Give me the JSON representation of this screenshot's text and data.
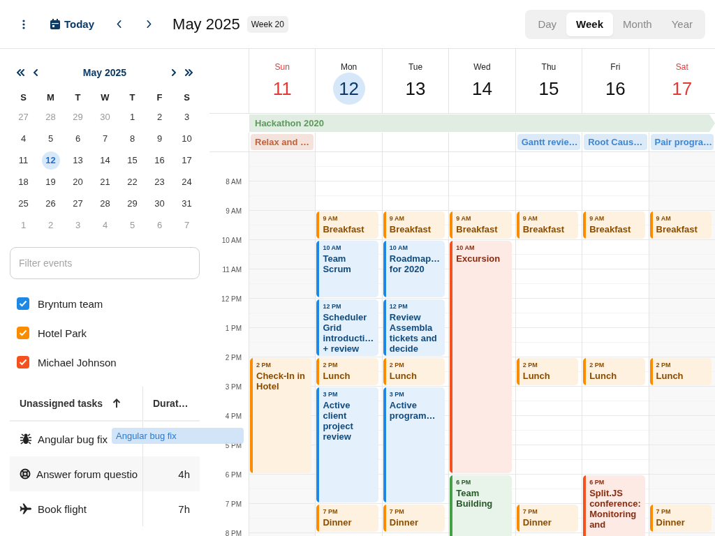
{
  "toolbar": {
    "today": "Today",
    "title": "May 2025",
    "week_badge": "Week 20",
    "views": [
      {
        "label": "Day",
        "selected": false
      },
      {
        "label": "Week",
        "selected": true
      },
      {
        "label": "Month",
        "selected": false
      },
      {
        "label": "Year",
        "selected": false
      }
    ]
  },
  "mini_calendar": {
    "title": "May 2025",
    "weekdays": [
      "S",
      "M",
      "T",
      "W",
      "T",
      "F",
      "S"
    ],
    "weeks": [
      [
        {
          "day": "27",
          "other_month": true,
          "selected": false
        },
        {
          "day": "28",
          "other_month": true,
          "selected": false
        },
        {
          "day": "29",
          "other_month": true,
          "selected": false
        },
        {
          "day": "30",
          "other_month": true,
          "selected": false
        },
        {
          "day": "1",
          "other_month": false,
          "selected": false
        },
        {
          "day": "2",
          "other_month": false,
          "selected": false
        },
        {
          "day": "3",
          "other_month": false,
          "selected": false
        }
      ],
      [
        {
          "day": "4",
          "other_month": false,
          "selected": false
        },
        {
          "day": "5",
          "other_month": false,
          "selected": false
        },
        {
          "day": "6",
          "other_month": false,
          "selected": false
        },
        {
          "day": "7",
          "other_month": false,
          "selected": false
        },
        {
          "day": "8",
          "other_month": false,
          "selected": false
        },
        {
          "day": "9",
          "other_month": false,
          "selected": false
        },
        {
          "day": "10",
          "other_month": false,
          "selected": false
        }
      ],
      [
        {
          "day": "11",
          "other_month": false,
          "selected": false
        },
        {
          "day": "12",
          "other_month": false,
          "selected": true
        },
        {
          "day": "13",
          "other_month": false,
          "selected": false
        },
        {
          "day": "14",
          "other_month": false,
          "selected": false
        },
        {
          "day": "15",
          "other_month": false,
          "selected": false
        },
        {
          "day": "16",
          "other_month": false,
          "selected": false
        },
        {
          "day": "17",
          "other_month": false,
          "selected": false
        }
      ],
      [
        {
          "day": "18",
          "other_month": false,
          "selected": false
        },
        {
          "day": "19",
          "other_month": false,
          "selected": false
        },
        {
          "day": "20",
          "other_month": false,
          "selected": false
        },
        {
          "day": "21",
          "other_month": false,
          "selected": false
        },
        {
          "day": "22",
          "other_month": false,
          "selected": false
        },
        {
          "day": "23",
          "other_month": false,
          "selected": false
        },
        {
          "day": "24",
          "other_month": false,
          "selected": false
        }
      ],
      [
        {
          "day": "25",
          "other_month": false,
          "selected": false
        },
        {
          "day": "26",
          "other_month": false,
          "selected": false
        },
        {
          "day": "27",
          "other_month": false,
          "selected": false
        },
        {
          "day": "28",
          "other_month": false,
          "selected": false
        },
        {
          "day": "29",
          "other_month": false,
          "selected": false
        },
        {
          "day": "30",
          "other_month": false,
          "selected": false
        },
        {
          "day": "31",
          "other_month": false,
          "selected": false
        }
      ],
      [
        {
          "day": "1",
          "other_month": true,
          "selected": false
        },
        {
          "day": "2",
          "other_month": true,
          "selected": false
        },
        {
          "day": "3",
          "other_month": true,
          "selected": false
        },
        {
          "day": "4",
          "other_month": true,
          "selected": false
        },
        {
          "day": "5",
          "other_month": true,
          "selected": false
        },
        {
          "day": "6",
          "other_month": true,
          "selected": false
        },
        {
          "day": "7",
          "other_month": true,
          "selected": false
        }
      ]
    ]
  },
  "filter": {
    "placeholder": "Filter events"
  },
  "calendars": [
    {
      "name": "Bryntum team",
      "checked": true,
      "color": "#1e88e5"
    },
    {
      "name": "Hotel Park",
      "checked": true,
      "color": "#fb8c00"
    },
    {
      "name": "Michael Johnson",
      "checked": true,
      "color": "#f4511e"
    }
  ],
  "tasks": {
    "columns": [
      "Unassigned tasks",
      "Durat…"
    ],
    "rows": [
      {
        "kind": "bug",
        "name": "Angular bug fix"
      },
      {
        "kind": "lifebuoy",
        "name": "Answer forum questio",
        "duration": "4h"
      },
      {
        "kind": "plane",
        "name": "Book flight",
        "duration": "7h"
      }
    ]
  },
  "drag_proxy": {
    "title": "Angular bug fix"
  },
  "week": {
    "hours": [
      "8 AM",
      "9 AM",
      "10 AM",
      "11 AM",
      "12 PM",
      "1 PM",
      "2 PM",
      "3 PM",
      "4 PM",
      "5 PM",
      "6 PM",
      "7 PM",
      "8 PM"
    ],
    "banner": {
      "title": "Hackathon 2020",
      "color": "#5b9a5c"
    },
    "days": [
      {
        "name": "Sun",
        "date": "11",
        "weekend": true,
        "today": false,
        "all_day": [
          {
            "title": "Relax and …",
            "color": "#c0623a"
          }
        ],
        "events": [
          {
            "time": "2 PM",
            "title": "Check-In in Hotel",
            "color": "#fb8c00",
            "kind": "quadruple"
          }
        ]
      },
      {
        "name": "Mon",
        "date": "12",
        "weekend": false,
        "today": true,
        "events": [
          {
            "time": "9 AM",
            "title": "Breakfast",
            "color": "#fb8c00",
            "kind": "single"
          },
          {
            "time": "10 AM",
            "title": "Team Scrum",
            "color": "#1e88e5",
            "kind": "double"
          },
          {
            "time": "12 PM",
            "title": "Scheduler Grid introducti… + review",
            "color": "#1e88e5",
            "kind": "double"
          },
          {
            "time": "2 PM",
            "title": "Lunch",
            "color": "#fb8c00",
            "kind": "single"
          },
          {
            "time": "3 PM",
            "title": "Active client project review",
            "color": "#1e88e5",
            "kind": "quadruple"
          },
          {
            "time": "7 PM",
            "title": "Dinner",
            "color": "#fb8c00",
            "kind": "single"
          }
        ]
      },
      {
        "name": "Tue",
        "date": "13",
        "weekend": false,
        "today": false,
        "events": [
          {
            "time": "9 AM",
            "title": "Breakfast",
            "color": "#fb8c00",
            "kind": "single"
          },
          {
            "time": "10 AM",
            "title": "Roadmap… for 2020",
            "color": "#1e88e5",
            "kind": "double"
          },
          {
            "time": "12 PM",
            "title": "Review Assembla tickets and decide",
            "color": "#1e88e5",
            "kind": "double"
          },
          {
            "time": "2 PM",
            "title": "Lunch",
            "color": "#fb8c00",
            "kind": "single"
          },
          {
            "time": "3 PM",
            "title": "Active program…",
            "color": "#1e88e5",
            "kind": "quadruple"
          },
          {
            "time": "7 PM",
            "title": "Dinner",
            "color": "#fb8c00",
            "kind": "single"
          }
        ]
      },
      {
        "name": "Wed",
        "date": "14",
        "weekend": false,
        "today": false,
        "events": [
          {
            "time": "9 AM",
            "title": "Breakfast",
            "color": "#fb8c00",
            "kind": "single"
          },
          {
            "time": "10 AM",
            "title": "Excursion",
            "color": "#f4511e",
            "kind": "octuple"
          },
          {
            "time": "6 PM",
            "title": "Team Building",
            "color": "#43a047",
            "kind": "quadruple"
          }
        ]
      },
      {
        "name": "Thu",
        "date": "15",
        "weekend": false,
        "today": false,
        "all_day": [
          {
            "title": "Gantt revie…",
            "color": "#3d87d4"
          }
        ],
        "events": [
          {
            "time": "9 AM",
            "title": "Breakfast",
            "color": "#fb8c00",
            "kind": "single"
          },
          {
            "time": "2 PM",
            "title": "Lunch",
            "color": "#fb8c00",
            "kind": "single"
          },
          {
            "time": "7 PM",
            "title": "Dinner",
            "color": "#fb8c00",
            "kind": "single"
          }
        ]
      },
      {
        "name": "Fri",
        "date": "16",
        "weekend": false,
        "today": false,
        "all_day": [
          {
            "title": "Root Caus…",
            "color": "#3d87d4"
          }
        ],
        "events": [
          {
            "time": "9 AM",
            "title": "Breakfast",
            "color": "#fb8c00",
            "kind": "single"
          },
          {
            "time": "2 PM",
            "title": "Lunch",
            "color": "#fb8c00",
            "kind": "single"
          },
          {
            "time": "6 PM",
            "title": "Split.JS conference: Monitoring and",
            "color": "#f4511e",
            "kind": "quadruple"
          }
        ]
      },
      {
        "name": "Sat",
        "date": "17",
        "weekend": true,
        "today": false,
        "all_day": [
          {
            "title": "Pair progra…",
            "color": "#3d87d4"
          }
        ],
        "events": [
          {
            "time": "9 AM",
            "title": "Breakfast",
            "color": "#fb8c00",
            "kind": "single"
          },
          {
            "time": "2 PM",
            "title": "Lunch",
            "color": "#fb8c00",
            "kind": "single"
          },
          {
            "time": "7 PM",
            "title": "Dinner",
            "color": "#fb8c00",
            "kind": "single"
          }
        ]
      }
    ]
  }
}
